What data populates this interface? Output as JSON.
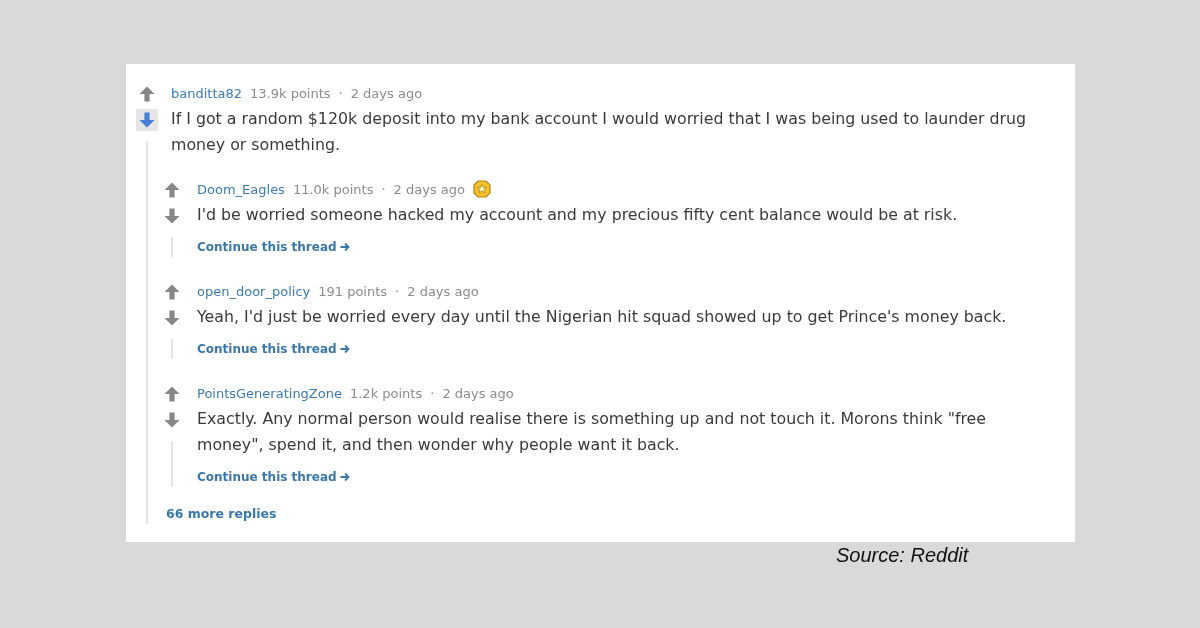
{
  "comments": [
    {
      "author": "banditta82",
      "points": "13.9k points",
      "separator": "·",
      "time": "2 days ago",
      "awarded": false,
      "upvoted": false,
      "downvoted": true,
      "body": "If I got a random $120k deposit into my bank account I would worried that I was being used to launder drug money or something.",
      "children": [
        {
          "author": "Doom_Eagles",
          "points": "11.0k points",
          "separator": "·",
          "time": "2 days ago",
          "awarded": true,
          "upvoted": false,
          "downvoted": false,
          "body": "I'd be worried someone hacked my account and my precious fifty cent balance would be at risk.",
          "continue_link": "Continue this thread"
        },
        {
          "author": "open_door_policy",
          "points": "191 points",
          "separator": "·",
          "time": "2 days ago",
          "awarded": false,
          "upvoted": false,
          "downvoted": false,
          "body": "Yeah, I'd just be worried every day until the Nigerian hit squad showed up to get Prince's money back.",
          "continue_link": "Continue this thread"
        },
        {
          "author": "PointsGeneratingZone",
          "points": "1.2k points",
          "separator": "·",
          "time": "2 days ago",
          "awarded": false,
          "upvoted": false,
          "downvoted": false,
          "body": "Exactly. Any normal person would realise there is something up and not touch it. Morons think \"free money\", spend it, and then wonder why people want it back.",
          "continue_link": "Continue this thread"
        }
      ],
      "more_replies": "66 more replies"
    }
  ],
  "caption": "Source: Reddit"
}
